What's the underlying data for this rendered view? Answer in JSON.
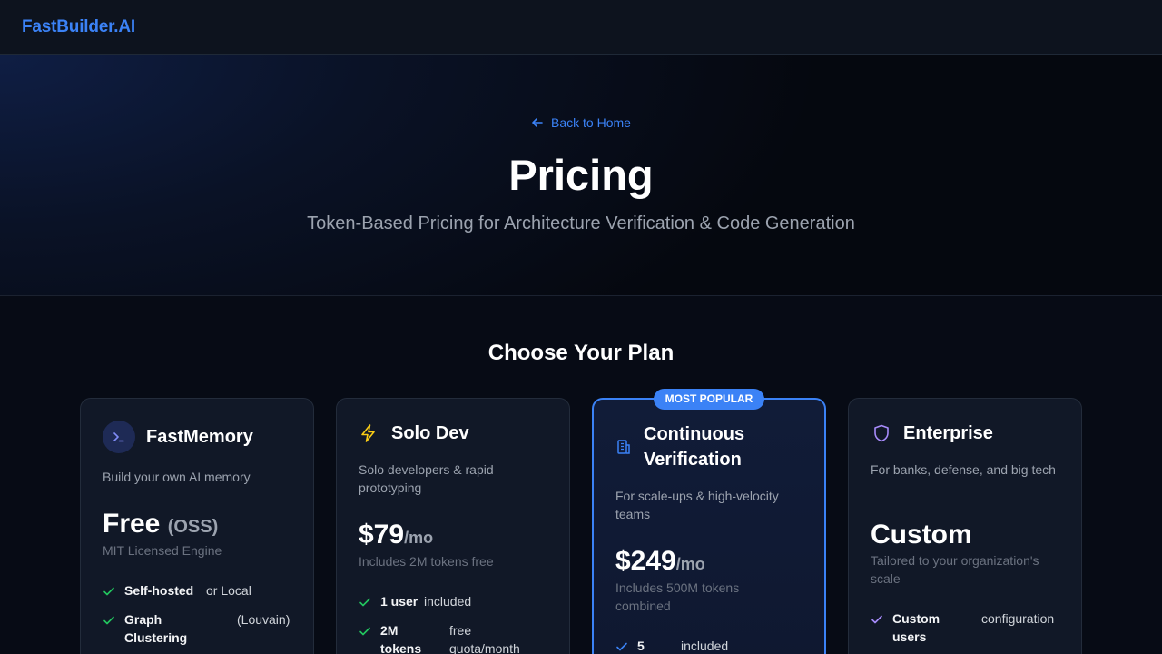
{
  "header": {
    "brand": "FastBuilder.AI"
  },
  "hero": {
    "back_link": "Back to Home",
    "title": "Pricing",
    "subtitle": "Token-Based Pricing for Architecture Verification & Code Generation"
  },
  "plans_section": {
    "title": "Choose Your Plan"
  },
  "colors": {
    "accent": "#3b82f6",
    "check_green": "#22c55e",
    "check_purple": "#a78bfa",
    "bolt_yellow": "#facc15"
  },
  "plans": [
    {
      "icon": "terminal-icon",
      "name": "FastMemory",
      "description": "Build your own AI memory",
      "price": "Free",
      "price_suffix": "(OSS)",
      "price_note": "MIT Licensed Engine",
      "features": [
        {
          "strong": "Self-hosted",
          "rest": "or Local"
        },
        {
          "strong": "Graph Clustering",
          "rest": "(Louvain)"
        }
      ]
    },
    {
      "icon": "bolt-icon",
      "name": "Solo Dev",
      "description": "Solo developers & rapid prototyping",
      "price": "$79",
      "price_unit": "/mo",
      "price_note": "Includes 2M tokens free",
      "features": [
        {
          "strong": "1 user",
          "rest": "included"
        },
        {
          "strong": "2M tokens",
          "rest": "free quota/month"
        }
      ]
    },
    {
      "icon": "building-icon",
      "badge": "MOST POPULAR",
      "name": "Continuous Verification",
      "description": "For scale-ups & high-velocity teams",
      "price": "$249",
      "price_unit": "/mo",
      "price_note": "Includes 500M tokens combined",
      "features": [
        {
          "strong": "5",
          "rest": "included"
        }
      ]
    },
    {
      "icon": "shield-icon",
      "name": "Enterprise",
      "description": "For banks, defense, and big tech",
      "price": "Custom",
      "price_note": "Tailored to your organization's scale",
      "features": [
        {
          "strong": "Custom users",
          "rest": "configuration"
        }
      ]
    }
  ]
}
